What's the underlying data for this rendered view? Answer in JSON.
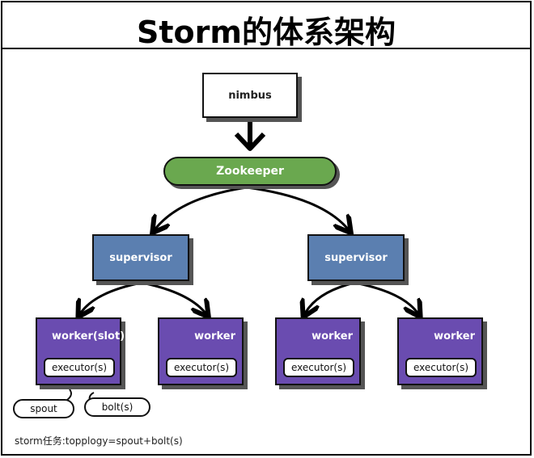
{
  "title": "Storm的体系架构",
  "nodes": {
    "nimbus": "nimbus",
    "zookeeper": "Zookeeper",
    "supervisors": [
      "supervisor",
      "supervisor"
    ],
    "workers": [
      {
        "label": "worker(slot)",
        "executor": "executor(s)"
      },
      {
        "label": "worker",
        "executor": "executor(s)"
      },
      {
        "label": "worker",
        "executor": "executor(s)"
      },
      {
        "label": "worker",
        "executor": "executor(s)"
      }
    ]
  },
  "bubbles": [
    "spout",
    "bolt(s)"
  ],
  "note": "storm任务:topplogy=spout+bolt(s)",
  "colors": {
    "zookeeper": "#6aa84f",
    "supervisor": "#5b7fb0",
    "worker": "#6a4cb0"
  }
}
